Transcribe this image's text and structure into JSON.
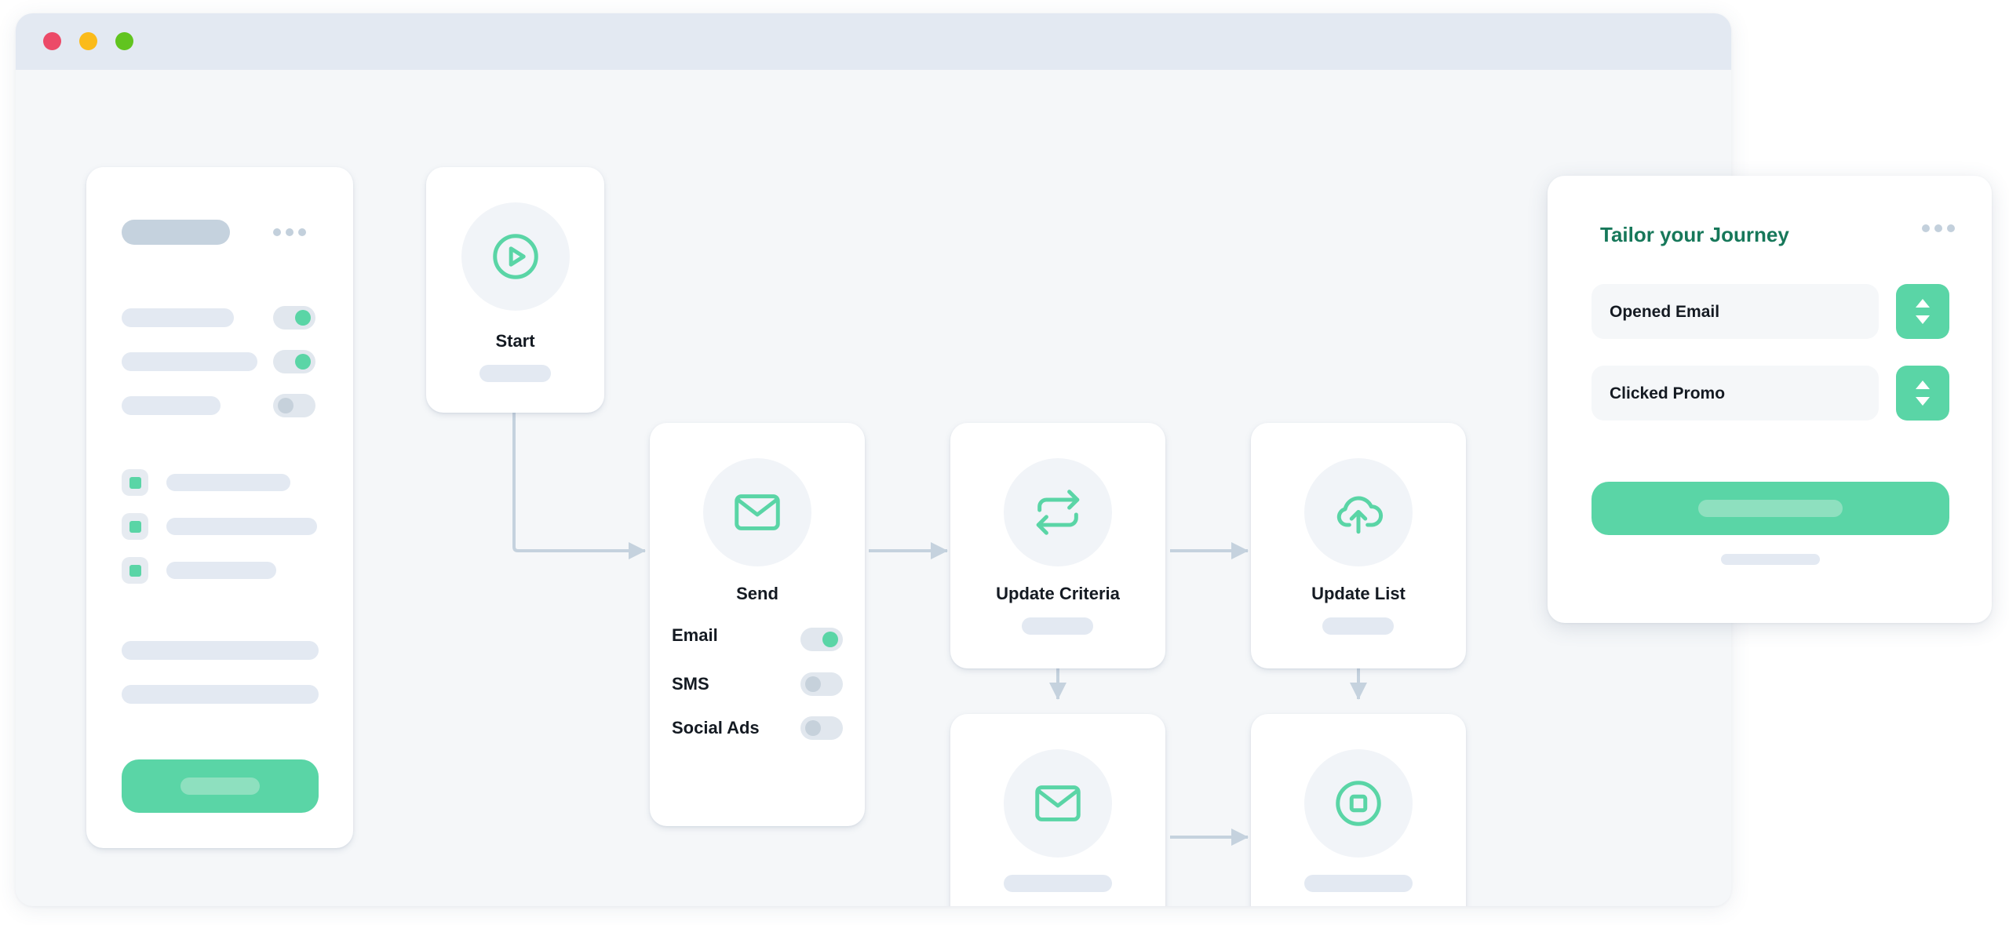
{
  "window": {
    "controls": [
      "close",
      "minimize",
      "maximize"
    ]
  },
  "sidebar": {
    "toggles": [
      {
        "state": "on"
      },
      {
        "state": "on"
      },
      {
        "state": "off"
      }
    ],
    "checkboxes": [
      {
        "checked": true
      },
      {
        "checked": true
      },
      {
        "checked": true
      }
    ]
  },
  "flow": {
    "start": {
      "label": "Start",
      "icon": "play-icon"
    },
    "send": {
      "label": "Send",
      "icon": "mail-icon",
      "channels": [
        {
          "label": "Email",
          "enabled": true
        },
        {
          "label": "SMS",
          "enabled": false
        },
        {
          "label": "Social Ads",
          "enabled": false
        }
      ]
    },
    "update_criteria": {
      "label": "Update Criteria",
      "icon": "repeat-icon"
    },
    "update_list": {
      "label": "Update List",
      "icon": "cloud-upload-icon"
    },
    "email_step": {
      "icon": "mail-icon"
    },
    "stop_step": {
      "icon": "stop-icon"
    }
  },
  "panel": {
    "title": "Tailor your Journey",
    "fields": [
      {
        "label": "Opened Email"
      },
      {
        "label": "Clicked Promo"
      }
    ]
  },
  "colors": {
    "accent": "#5ad5a6",
    "accent_dark": "#17785a",
    "title_bar": "#e3e9f2",
    "canvas": "#f5f7f9",
    "connector": "#c5d2de"
  }
}
